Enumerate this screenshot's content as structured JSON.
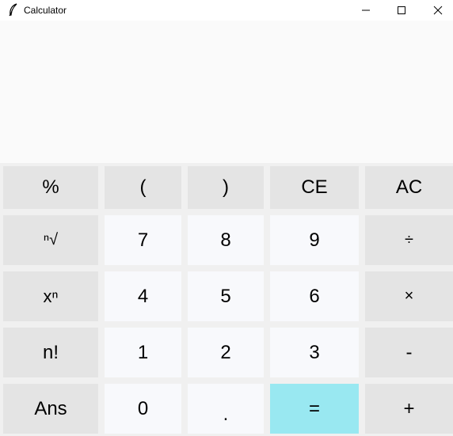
{
  "window": {
    "title": "Calculator",
    "icon": "feather-icon",
    "controls": [
      "minimize-icon",
      "maximize-icon",
      "close-icon"
    ]
  },
  "display": {
    "value": ""
  },
  "keys": {
    "percent": "%",
    "lparen": "(",
    "rparen": ")",
    "ce": "CE",
    "ac": "AC",
    "nthroot": "ⁿ√",
    "seven": "7",
    "eight": "8",
    "nine": "9",
    "divide": "÷",
    "power": "xⁿ",
    "four": "4",
    "five": "5",
    "six": "6",
    "multiply": "×",
    "factorial": "n!",
    "one": "1",
    "two": "2",
    "three": "3",
    "minus": "-",
    "ans": "Ans",
    "zero": "0",
    "dot": ".",
    "equals": "=",
    "plus": "+"
  },
  "colors": {
    "operator_key": "#e4e4e4",
    "number_key": "#f8f9fc",
    "equals_key": "#99e8f1",
    "display_bg": "#fafafa",
    "window_bg": "#f0f0f0"
  }
}
